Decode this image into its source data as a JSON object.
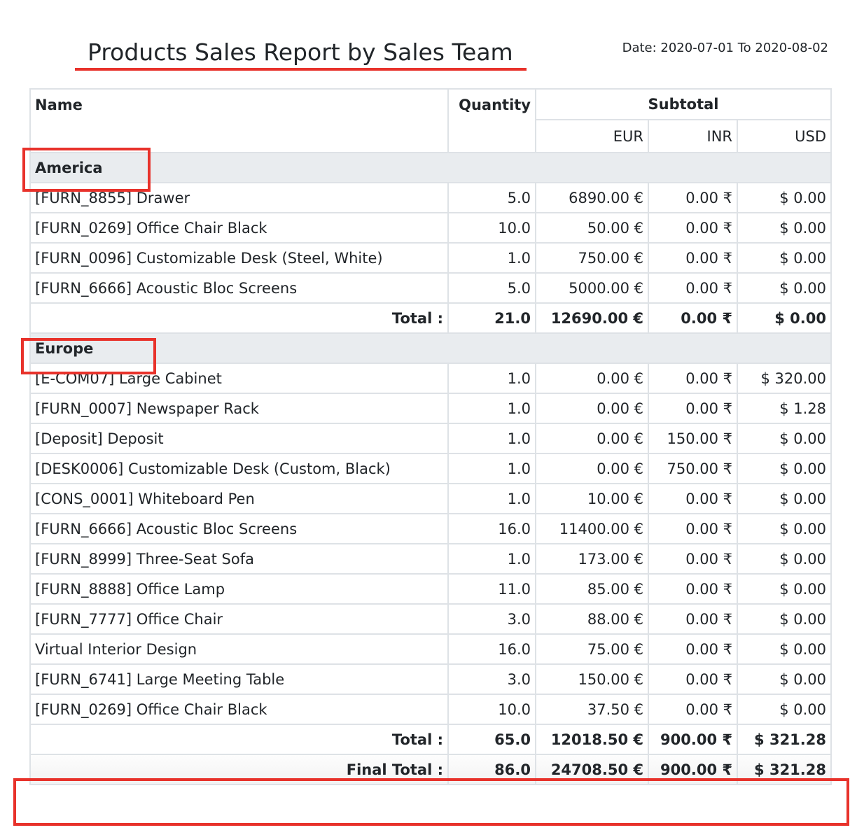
{
  "report": {
    "title": "Products Sales Report by Sales Team",
    "date_range": "Date: 2020-07-01 To 2020-08-02"
  },
  "table": {
    "headers": {
      "name": "Name",
      "quantity": "Quantity",
      "subtotal": "Subtotal"
    },
    "currencies": [
      "EUR",
      "INR",
      "USD"
    ],
    "groups": [
      {
        "name": "America",
        "rows": [
          {
            "name": "[FURN_8855] Drawer",
            "qty": "5.0",
            "eur": "6890.00 €",
            "inr": "0.00 ₹",
            "usd": "$ 0.00"
          },
          {
            "name": "[FURN_0269] Office Chair Black",
            "qty": "10.0",
            "eur": "50.00 €",
            "inr": "0.00 ₹",
            "usd": "$ 0.00"
          },
          {
            "name": "[FURN_0096] Customizable Desk (Steel, White)",
            "qty": "1.0",
            "eur": "750.00 €",
            "inr": "0.00 ₹",
            "usd": "$ 0.00"
          },
          {
            "name": "[FURN_6666] Acoustic Bloc Screens",
            "qty": "5.0",
            "eur": "5000.00 €",
            "inr": "0.00 ₹",
            "usd": "$ 0.00"
          }
        ],
        "total": {
          "label": "Total :",
          "qty": "21.0",
          "eur": "12690.00 €",
          "inr": "0.00 ₹",
          "usd": "$ 0.00"
        }
      },
      {
        "name": "Europe",
        "rows": [
          {
            "name": "[E-COM07] Large Cabinet",
            "qty": "1.0",
            "eur": "0.00 €",
            "inr": "0.00 ₹",
            "usd": "$ 320.00"
          },
          {
            "name": "[FURN_0007] Newspaper Rack",
            "qty": "1.0",
            "eur": "0.00 €",
            "inr": "0.00 ₹",
            "usd": "$ 1.28"
          },
          {
            "name": "[Deposit] Deposit",
            "qty": "1.0",
            "eur": "0.00 €",
            "inr": "150.00 ₹",
            "usd": "$ 0.00"
          },
          {
            "name": "[DESK0006] Customizable Desk (Custom, Black)",
            "qty": "1.0",
            "eur": "0.00 €",
            "inr": "750.00 ₹",
            "usd": "$ 0.00"
          },
          {
            "name": "[CONS_0001] Whiteboard Pen",
            "qty": "1.0",
            "eur": "10.00 €",
            "inr": "0.00 ₹",
            "usd": "$ 0.00"
          },
          {
            "name": "[FURN_6666] Acoustic Bloc Screens",
            "qty": "16.0",
            "eur": "11400.00 €",
            "inr": "0.00 ₹",
            "usd": "$ 0.00"
          },
          {
            "name": "[FURN_8999] Three-Seat Sofa",
            "qty": "1.0",
            "eur": "173.00 €",
            "inr": "0.00 ₹",
            "usd": "$ 0.00"
          },
          {
            "name": "[FURN_8888] Office Lamp",
            "qty": "11.0",
            "eur": "85.00 €",
            "inr": "0.00 ₹",
            "usd": "$ 0.00"
          },
          {
            "name": "[FURN_7777] Office Chair",
            "qty": "3.0",
            "eur": "88.00 €",
            "inr": "0.00 ₹",
            "usd": "$ 0.00"
          },
          {
            "name": "Virtual Interior Design",
            "qty": "16.0",
            "eur": "75.00 €",
            "inr": "0.00 ₹",
            "usd": "$ 0.00"
          },
          {
            "name": "[FURN_6741] Large Meeting Table",
            "qty": "3.0",
            "eur": "150.00 €",
            "inr": "0.00 ₹",
            "usd": "$ 0.00"
          },
          {
            "name": "[FURN_0269] Office Chair Black",
            "qty": "10.0",
            "eur": "37.50 €",
            "inr": "0.00 ₹",
            "usd": "$ 0.00"
          }
        ],
        "total": {
          "label": "Total :",
          "qty": "65.0",
          "eur": "12018.50 €",
          "inr": "900.00 ₹",
          "usd": "$ 321.28"
        }
      }
    ],
    "final_total": {
      "label": "Final Total :",
      "qty": "86.0",
      "eur": "24708.50 €",
      "inr": "900.00 ₹",
      "usd": "$ 321.28"
    }
  },
  "colors": {
    "highlight": "#e8322b",
    "group_bg": "#e9ecef",
    "border": "#dee2e6"
  }
}
